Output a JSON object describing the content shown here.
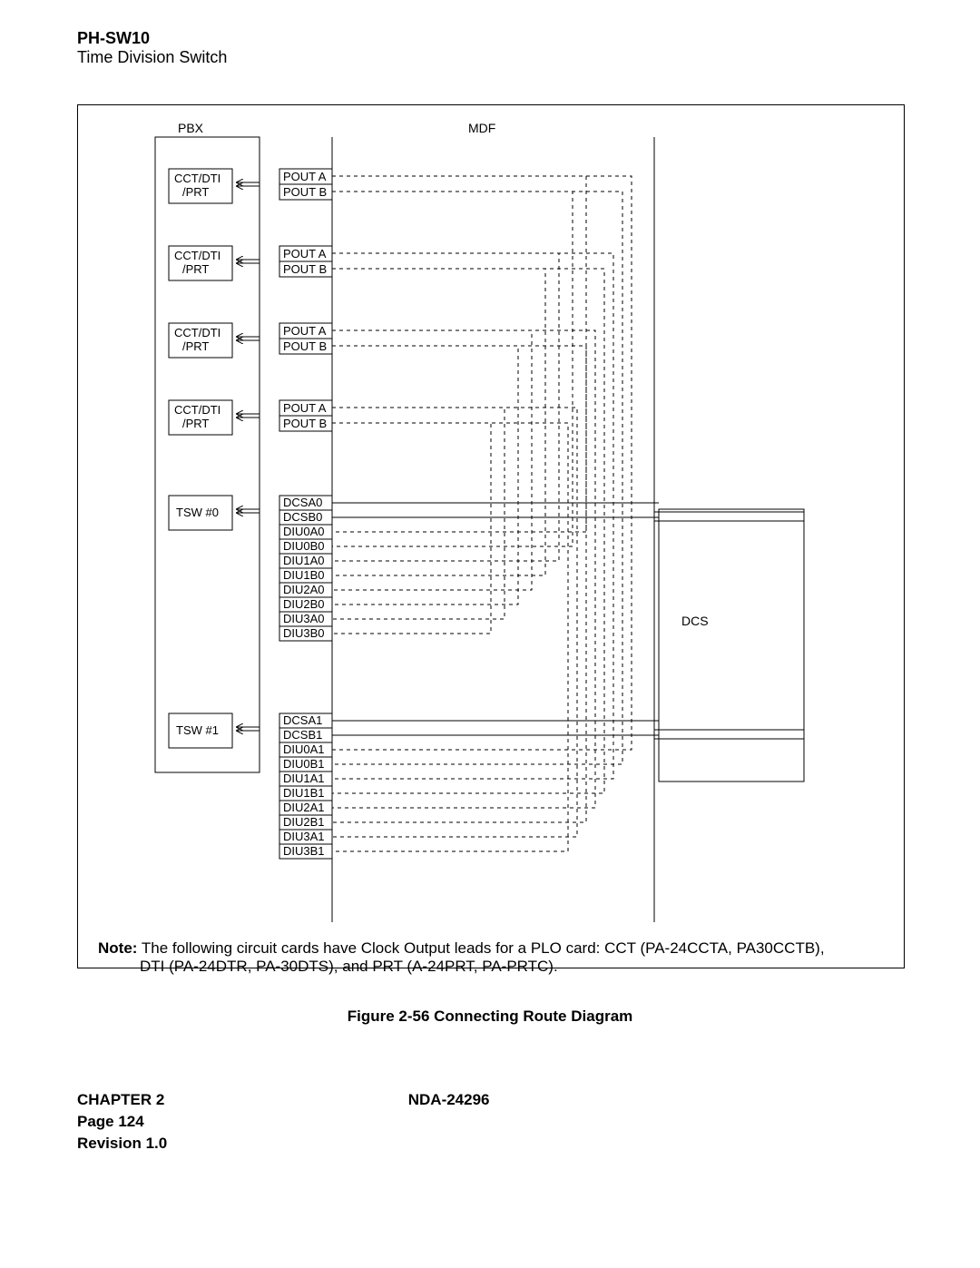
{
  "header": {
    "model": "PH-SW10",
    "subtitle": "Time Division Switch"
  },
  "diagram": {
    "sections": {
      "pbx": "PBX",
      "mdf": "MDF"
    },
    "cct_boxes": [
      {
        "line1": "CCT/DTI",
        "line2": "/PRT",
        "outA": "POUT A",
        "outB": "POUT B"
      },
      {
        "line1": "CCT/DTI",
        "line2": "/PRT",
        "outA": "POUT A",
        "outB": "POUT B"
      },
      {
        "line1": "CCT/DTI",
        "line2": "/PRT",
        "outA": "POUT A",
        "outB": "POUT B"
      },
      {
        "line1": "CCT/DTI",
        "line2": "/PRT",
        "outA": "POUT A",
        "outB": "POUT B"
      }
    ],
    "tsw": [
      {
        "label": "TSW #0",
        "signals": [
          "DCSA0",
          "DCSB0",
          "DIU0A0",
          "DIU0B0",
          "DIU1A0",
          "DIU1B0",
          "DIU2A0",
          "DIU2B0",
          "DIU3A0",
          "DIU3B0"
        ]
      },
      {
        "label": "TSW #1",
        "signals": [
          "DCSA1",
          "DCSB1",
          "DIU0A1",
          "DIU0B1",
          "DIU1A1",
          "DIU1B1",
          "DIU2A1",
          "DIU2B1",
          "DIU3A1",
          "DIU3B1"
        ]
      }
    ],
    "dcs_label": "DCS"
  },
  "note_label": "Note:",
  "note_text1": " The following circuit cards have Clock Output leads for a PLO card:  CCT (PA-24CCTA, PA30CCTB),",
  "note_text2": "DTI (PA-24DTR, PA-30DTS), and PRT (A-24PRT, PA-PRTC).",
  "figure_caption": "Figure 2-56   Connecting Route Diagram",
  "footer": {
    "chapter": "CHAPTER 2",
    "docnum": "NDA-24296",
    "page": "Page 124",
    "revision": "Revision 1.0"
  }
}
